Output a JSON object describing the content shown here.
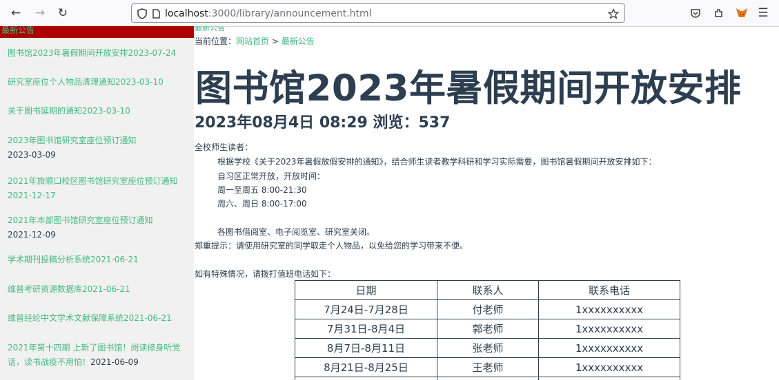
{
  "browser": {
    "url_host": "localhost",
    "url_path": ":3000/library/announcement.html"
  },
  "sidebar": {
    "header": "最新公告",
    "items": [
      {
        "title": "图书馆2023年暑假期间开放安排",
        "date": "2023-07-24"
      },
      {
        "title": "研究室座位个人物品清理通知",
        "date": "2023-03-10"
      },
      {
        "title": "关于图书延期的通知",
        "date": "2023-03-10"
      },
      {
        "title": "2023年图书馆研究室座位预订通知",
        "date": "2023-03-09"
      },
      {
        "title": "2021年旅顺口校区图书馆研究室座位预订通知",
        "date": "2021-12-17"
      },
      {
        "title": "2021年本部图书馆研究室座位预订通知",
        "date": "2021-12-09"
      },
      {
        "title": "学术期刊投稿分析系统",
        "date": "2021-06-21"
      },
      {
        "title": "维普考研资源数据库",
        "date": "2021-06-21"
      },
      {
        "title": "维普经纶中文学术文献保障系统",
        "date": "2021-06-21"
      },
      {
        "title": "2021年第十四期 上新了图书馆！阅读修身听党话，读书战疫不用怕！",
        "date": "2021-06-09"
      }
    ]
  },
  "main": {
    "crumb_top": "最新公告",
    "crumb_prefix": "当前位置：",
    "crumb_home": "网站首页",
    "crumb_sep": " > ",
    "crumb_current": "最新公告",
    "title": "图书馆2023年暑假期间开放安排",
    "meta": "2023年08月4日 08:29 浏览：537",
    "lines": [
      "全校师生读者：",
      "根据学校《关于2023年暑假放假安排的通知》，结合师生读者教学科研和学习实际需要，图书馆暑假期间开放安排如下：",
      "自习区正常开放，开放时间：",
      "周一至周五 8:00-21:30",
      "周六、周日 8:00-17:00",
      "各图书借阅室、电子阅览室、研究室关闭。",
      "郑重提示：请使用研究室的同学取走个人物品，以免给您的学习带来不便。",
      "如有特殊情况，请拨打值班电话如下："
    ],
    "table": {
      "headers": [
        "日期",
        "联系人",
        "联系电话"
      ],
      "rows": [
        [
          "7月24日-7月28日",
          "付老师",
          "1xxxxxxxxxx"
        ],
        [
          "7月31日-8月4日",
          "郭老师",
          "1xxxxxxxxxx"
        ],
        [
          "8月7日-8月11日",
          "张老师",
          "1xxxxxxxxxx"
        ],
        [
          "8月21日-8月25日",
          "王老师",
          "1xxxxxxxxxx"
        ]
      ]
    }
  }
}
